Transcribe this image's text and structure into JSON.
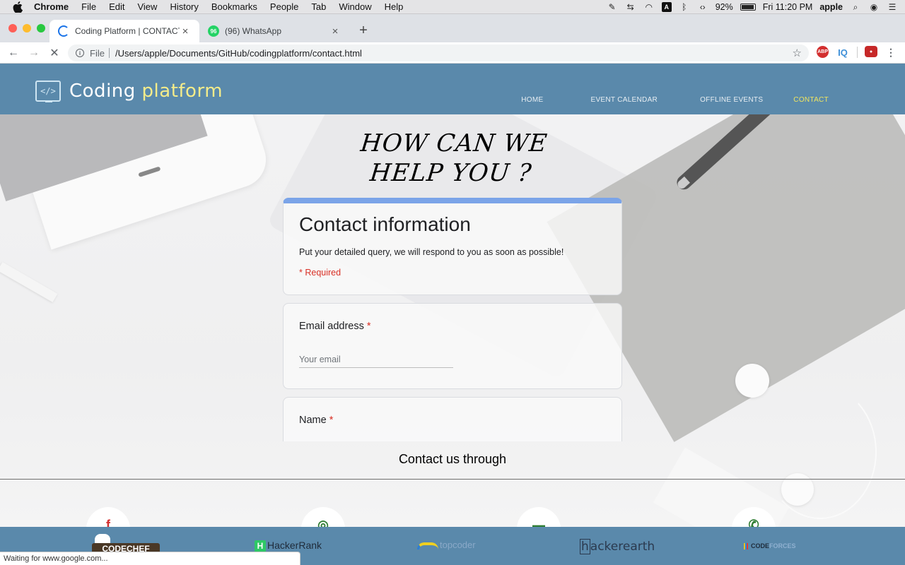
{
  "menubar": {
    "app": "Chrome",
    "items": [
      "File",
      "Edit",
      "View",
      "History",
      "Bookmarks",
      "People",
      "Tab",
      "Window",
      "Help"
    ],
    "battery": "92%",
    "clock": "Fri 11:20 PM",
    "user": "apple"
  },
  "tabs": [
    {
      "title": "Coding Platform | CONTACT US"
    },
    {
      "title": "(96) WhatsApp"
    }
  ],
  "toolbar": {
    "scheme": "File",
    "url": "/Users/apple/Documents/GitHub/codingplatform/contact.html"
  },
  "extensions": {
    "abp": "ABP",
    "iq": "IQ"
  },
  "site": {
    "logo_main": "Coding ",
    "logo_accent": "platform",
    "logo_mark": "</>",
    "nav": {
      "home": "HOME",
      "calendar": "EVENT CALENDAR",
      "offline": "OFFLINE EVENTS",
      "contact": "CONTACT"
    },
    "headline_line1": "HOW CAN WE",
    "headline_line2": "HELP YOU ?"
  },
  "form": {
    "title": "Contact information",
    "description": "Put your detailed query, we will respond to you as soon as possible!",
    "required_note": "* Required",
    "email": {
      "label": "Email address",
      "required_mark": "*",
      "placeholder": "Your email"
    },
    "name": {
      "label": "Name",
      "required_mark": "*"
    }
  },
  "contact_through": "Contact us through",
  "sponsors": {
    "codechef": "CODECHEF",
    "hackerrank": "HackerRank",
    "topcoder": "topcoder",
    "hackerearth": "ackerearth",
    "codeforces_a": "CODE",
    "codeforces_b": "FORCES"
  },
  "status": "Waiting for www.google.com..."
}
